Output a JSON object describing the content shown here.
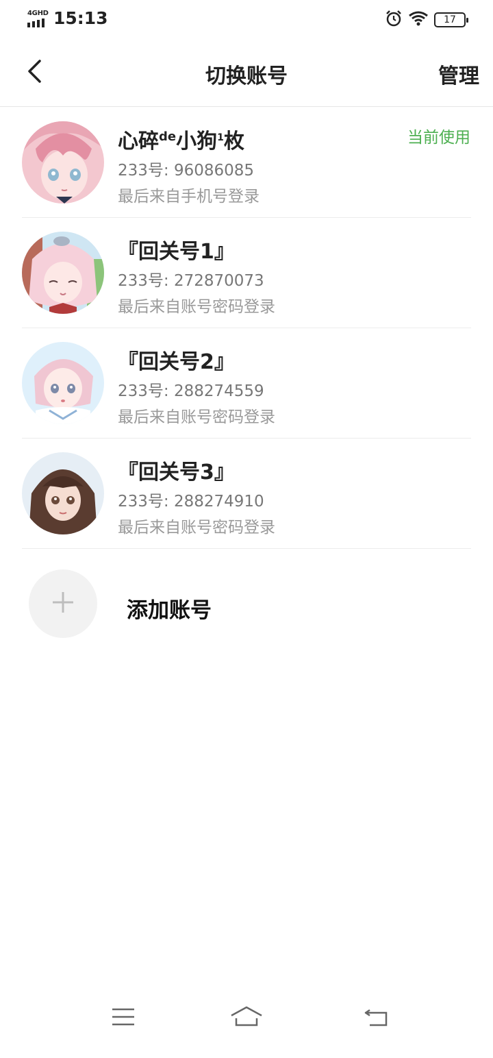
{
  "status_bar": {
    "network": "4GHD",
    "time": "15:13",
    "battery": "17",
    "icons": [
      "signal-icon",
      "alarm-icon",
      "wifi-icon",
      "battery-icon"
    ]
  },
  "header": {
    "title": "切换账号",
    "manage_label": "管理",
    "back_icon": "chevron-left-icon"
  },
  "accounts": [
    {
      "name": "心碎",
      "name_sup1": "de",
      "name_mid": "小狗",
      "name_sup2": "1",
      "name_end": "枚",
      "id_line": "233号: 96086085",
      "login": "最后来自手机号登录",
      "tag": "当前使用"
    },
    {
      "name": "『回关号1』",
      "id_line": "233号: 272870073",
      "login": "最后来自账号密码登录"
    },
    {
      "name": "『回关号2』",
      "id_line": "233号: 288274559",
      "login": "最后来自账号密码登录"
    },
    {
      "name": "『回关号3』",
      "id_line": "233号: 288274910",
      "login": "最后来自账号密码登录"
    }
  ],
  "add_account": {
    "label": "添加账号",
    "icon": "plus-icon"
  },
  "nav": {
    "icons": [
      "menu-icon",
      "home-icon",
      "back-icon"
    ]
  },
  "colors": {
    "current_tag": "#4caf50",
    "divider": "#ececec",
    "text_secondary": "#777777"
  }
}
